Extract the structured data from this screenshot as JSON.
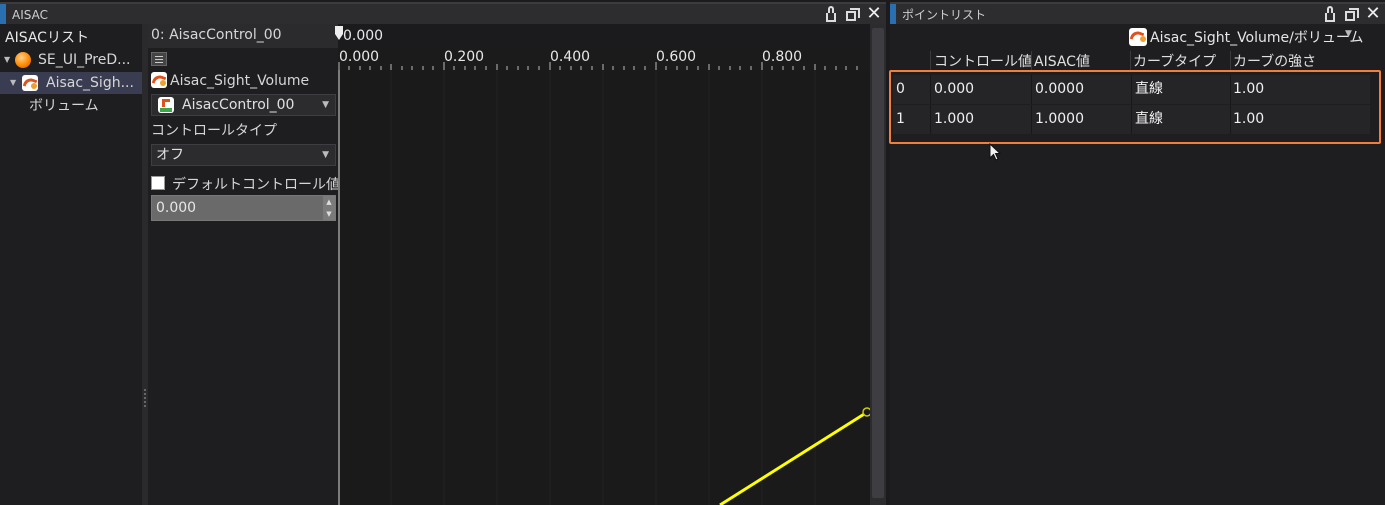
{
  "aisac_panel": {
    "title": "AISAC",
    "list_header": "AISACリスト",
    "tree": [
      {
        "label": "SE_UI_PreD...",
        "icon": "cue-orange-icon",
        "expanded": true
      },
      {
        "label": "Aisac_Sigh...",
        "icon": "aisac-curve-icon",
        "expanded": true,
        "selected": true
      },
      {
        "label": "ボリューム",
        "icon": ""
      }
    ]
  },
  "control": {
    "header_value": "0: AisacControl_00",
    "aisac_name": "Aisac_Sight_Volume",
    "control_select": "AisacControl_00",
    "control_type_label": "コントロールタイプ",
    "control_type_value": "オフ",
    "default_checkbox_label": "デフォルトコントロール値",
    "default_checked": false,
    "default_value": "0.000"
  },
  "graph": {
    "cursor_value": "0.000",
    "ticks": [
      "0.000",
      "0.200",
      "0.400",
      "0.600",
      "0.800"
    ]
  },
  "point_list": {
    "title": "ポイントリスト",
    "target": "Aisac_Sight_Volume/ボリューム",
    "columns": [
      "コントロール値",
      "AISAC値",
      "カーブタイプ",
      "カーブの強さ"
    ],
    "rows": [
      {
        "index": "0",
        "control": "0.000",
        "aisac": "0.0000",
        "curve_type": "直線",
        "strength": "1.00"
      },
      {
        "index": "1",
        "control": "1.000",
        "aisac": "1.0000",
        "curve_type": "直線",
        "strength": "1.00"
      }
    ]
  },
  "colors": {
    "highlight": "#f07f3c",
    "curve": "#ffff00",
    "selection": "#3a3d52",
    "accent": "#2a6fb0"
  }
}
